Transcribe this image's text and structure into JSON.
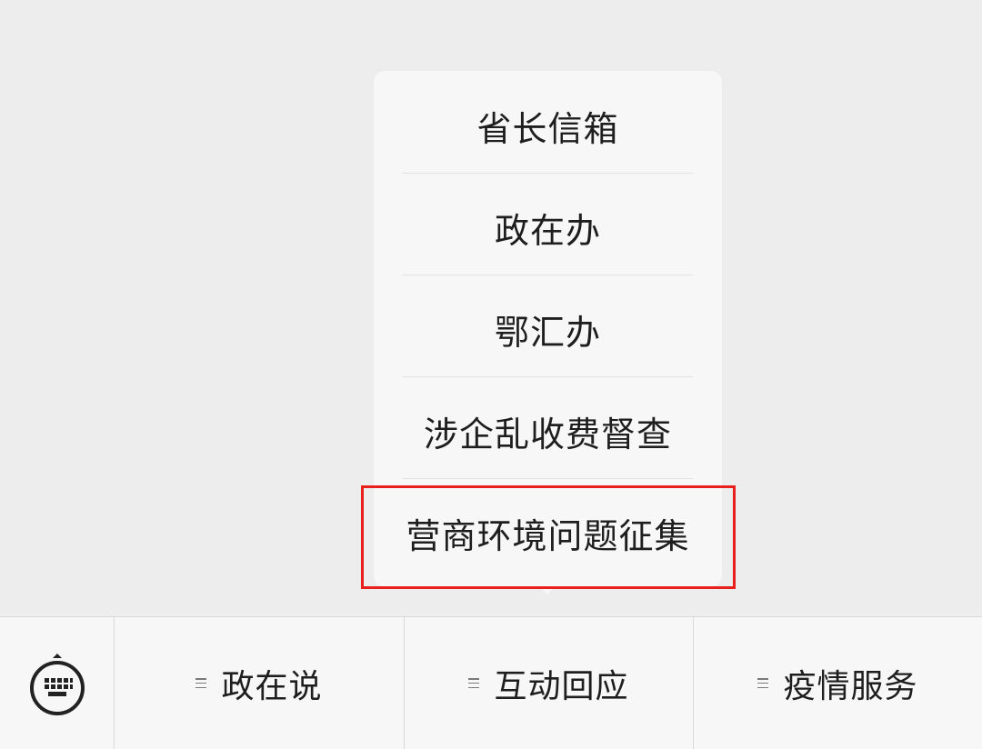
{
  "submenu": {
    "items": [
      {
        "label": "省长信箱"
      },
      {
        "label": "政在办"
      },
      {
        "label": "鄂汇办"
      },
      {
        "label": "涉企乱收费督查"
      },
      {
        "label": "营商环境问题征集"
      }
    ],
    "highlighted_index": 4
  },
  "menubar": {
    "keyboard_icon": "keyboard-icon",
    "items": [
      {
        "label": "政在说",
        "icon": "menu-lines-icon"
      },
      {
        "label": "互动回应",
        "icon": "menu-lines-icon"
      },
      {
        "label": "疫情服务",
        "icon": "menu-lines-icon"
      }
    ]
  },
  "colors": {
    "background": "#ededed",
    "panel": "#f7f7f7",
    "text": "#1e1e1e",
    "highlight": "#e8201c"
  }
}
